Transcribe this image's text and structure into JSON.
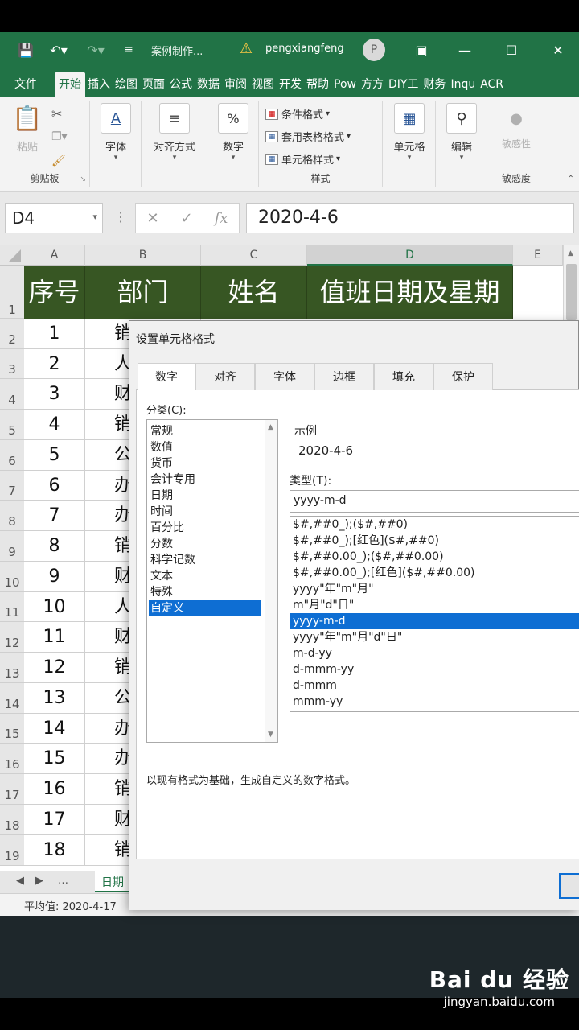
{
  "titlebar": {
    "doc_title": "案例制作...",
    "user": "pengxiangfeng",
    "avatar_initial": "P"
  },
  "tabs": [
    "文件",
    "开始",
    "插入",
    "绘图",
    "页面",
    "公式",
    "数据",
    "审阅",
    "视图",
    "开发",
    "帮助",
    "Pow",
    "方方",
    "DIY工",
    "财务",
    "Inqu",
    "ACR"
  ],
  "ribbon": {
    "paste": "粘贴",
    "clipboard": "剪贴板",
    "font": "字体",
    "align": "对齐方式",
    "number": "数字",
    "cond_format": "条件格式",
    "table_format": "套用表格格式",
    "cell_style": "单元格样式",
    "styles": "样式",
    "cells": "单元格",
    "edit": "编辑",
    "sensitivity": "敏感性",
    "sensitivity_group": "敏感度"
  },
  "formula": {
    "name_box": "D4",
    "content": "2020-4-6"
  },
  "columns": [
    "A",
    "B",
    "C",
    "D",
    "E"
  ],
  "header_row": [
    "序号",
    "部门",
    "姓名",
    "值班日期及星期"
  ],
  "row_numbers": [
    "1",
    "2",
    "3",
    "4",
    "5",
    "6",
    "7",
    "8",
    "9",
    "10",
    "11",
    "12",
    "13",
    "14",
    "15",
    "16",
    "17",
    "18",
    "19"
  ],
  "rows": [
    {
      "a": "1",
      "b": "销"
    },
    {
      "a": "2",
      "b": "人"
    },
    {
      "a": "3",
      "b": "财"
    },
    {
      "a": "4",
      "b": "销"
    },
    {
      "a": "5",
      "b": "公"
    },
    {
      "a": "6",
      "b": "办"
    },
    {
      "a": "7",
      "b": "办"
    },
    {
      "a": "8",
      "b": "销"
    },
    {
      "a": "9",
      "b": "财"
    },
    {
      "a": "10",
      "b": "人"
    },
    {
      "a": "11",
      "b": "财"
    },
    {
      "a": "12",
      "b": "销"
    },
    {
      "a": "13",
      "b": "公"
    },
    {
      "a": "14",
      "b": "办"
    },
    {
      "a": "15",
      "b": "办"
    },
    {
      "a": "16",
      "b": "销"
    },
    {
      "a": "17",
      "b": "财"
    },
    {
      "a": "18",
      "b": "销"
    }
  ],
  "sheet_tab": "日期",
  "status": {
    "average": "平均值: 2020-4-17"
  },
  "dialog": {
    "title": "设置单元格格式",
    "tabs": [
      "数字",
      "对齐",
      "字体",
      "边框",
      "填充",
      "保护"
    ],
    "category_label": "分类(C):",
    "categories": [
      "常规",
      "数值",
      "货币",
      "会计专用",
      "日期",
      "时间",
      "百分比",
      "分数",
      "科学记数",
      "文本",
      "特殊",
      "自定义"
    ],
    "sample_label": "示例",
    "sample_value": "2020-4-6",
    "type_label": "类型(T):",
    "type_value": "yyyy-m-d",
    "formats": [
      "$#,##0_);($#,##0)",
      "$#,##0_);[红色]($#,##0)",
      "$#,##0.00_);($#,##0.00)",
      "$#,##0.00_);[红色]($#,##0.00)",
      "yyyy\"年\"m\"月\"",
      "m\"月\"d\"日\"",
      "yyyy-m-d",
      "yyyy\"年\"m\"月\"d\"日\"",
      "m-d-yy",
      "d-mmm-yy",
      "d-mmm",
      "mmm-yy"
    ],
    "description": "以现有格式为基础，生成自定义的数字格式。"
  },
  "watermark": {
    "logo": "Bai du 经验",
    "url": "jingyan.baidu.com"
  }
}
